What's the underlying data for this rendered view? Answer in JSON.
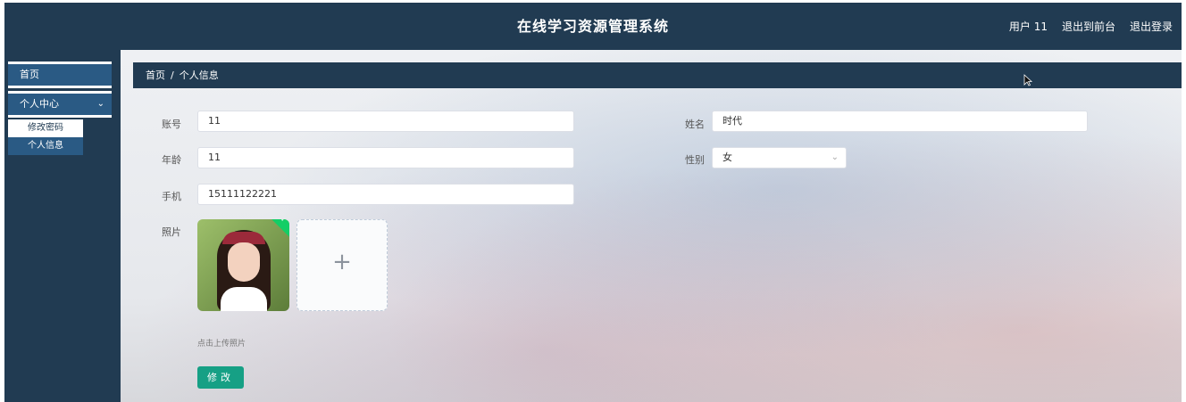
{
  "header": {
    "title": "在线学习资源管理系统",
    "user_label": "用户 11",
    "to_front_label": "退出到前台",
    "logout_label": "退出登录"
  },
  "sidebar": {
    "home_label": "首页",
    "center_label": "个人中心",
    "sub_items": [
      {
        "label": "修改密码",
        "selected": false
      },
      {
        "label": "个人信息",
        "selected": true
      }
    ]
  },
  "breadcrumb": {
    "home": "首页",
    "separator": "/",
    "current": "个人信息"
  },
  "form": {
    "account_label": "账号",
    "account_value": "11",
    "name_label": "姓名",
    "name_value": "时代",
    "age_label": "年龄",
    "age_value": "11",
    "gender_label": "性别",
    "gender_value": "女",
    "phone_label": "手机",
    "phone_value": "15111122221",
    "photo_label": "照片",
    "upload_plus": "+",
    "upload_hint": "点击上传照片",
    "submit_label": "修改"
  },
  "colors": {
    "navy": "#213b52",
    "menu_blue": "#2a5a84",
    "button_green": "#16a085"
  }
}
